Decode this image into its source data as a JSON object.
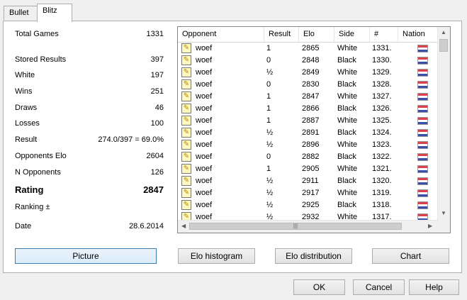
{
  "tabs": [
    {
      "label": "Bullet"
    },
    {
      "label": "Blitz"
    }
  ],
  "stats": {
    "total_games": {
      "label": "Total Games",
      "value": "1331"
    },
    "stored_results": {
      "label": "Stored Results",
      "value": "397"
    },
    "white": {
      "label": "White",
      "value": "197"
    },
    "wins": {
      "label": "Wins",
      "value": "251"
    },
    "draws": {
      "label": "Draws",
      "value": "46"
    },
    "losses": {
      "label": "Losses",
      "value": "100"
    },
    "result": {
      "label": "Result",
      "value": "274.0/397 = 69.0%"
    },
    "opponents_elo": {
      "label": "Opponents Elo",
      "value": "2604"
    },
    "n_opponents": {
      "label": "N Opponents",
      "value": "126"
    },
    "rating": {
      "label": "Rating",
      "value": "2847"
    },
    "ranking": {
      "label": "Ranking ±",
      "value": ""
    },
    "date": {
      "label": "Date",
      "value": "28.6.2014"
    }
  },
  "table": {
    "headers": {
      "opponent": "Opponent",
      "result": "Result",
      "elo": "Elo",
      "side": "Side",
      "num": "#",
      "nation": "Nation"
    },
    "rows": [
      {
        "opponent": "woef",
        "result": "1",
        "elo": "2865",
        "side": "White",
        "num": "1331."
      },
      {
        "opponent": "woef",
        "result": "0",
        "elo": "2848",
        "side": "Black",
        "num": "1330."
      },
      {
        "opponent": "woef",
        "result": "½",
        "elo": "2849",
        "side": "White",
        "num": "1329."
      },
      {
        "opponent": "woef",
        "result": "0",
        "elo": "2830",
        "side": "Black",
        "num": "1328."
      },
      {
        "opponent": "woef",
        "result": "1",
        "elo": "2847",
        "side": "White",
        "num": "1327."
      },
      {
        "opponent": "woef",
        "result": "1",
        "elo": "2866",
        "side": "Black",
        "num": "1326."
      },
      {
        "opponent": "woef",
        "result": "1",
        "elo": "2887",
        "side": "White",
        "num": "1325."
      },
      {
        "opponent": "woef",
        "result": "½",
        "elo": "2891",
        "side": "Black",
        "num": "1324."
      },
      {
        "opponent": "woef",
        "result": "½",
        "elo": "2896",
        "side": "White",
        "num": "1323."
      },
      {
        "opponent": "woef",
        "result": "0",
        "elo": "2882",
        "side": "Black",
        "num": "1322."
      },
      {
        "opponent": "woef",
        "result": "1",
        "elo": "2905",
        "side": "White",
        "num": "1321."
      },
      {
        "opponent": "woef",
        "result": "½",
        "elo": "2911",
        "side": "Black",
        "num": "1320."
      },
      {
        "opponent": "woef",
        "result": "½",
        "elo": "2917",
        "side": "White",
        "num": "1319."
      },
      {
        "opponent": "woef",
        "result": "½",
        "elo": "2925",
        "side": "Black",
        "num": "1318."
      },
      {
        "opponent": "woef",
        "result": "½",
        "elo": "2932",
        "side": "White",
        "num": "1317."
      }
    ]
  },
  "icons": {
    "row_icon": "pencil-icon",
    "nation_flag": "netherlands-flag-icon"
  },
  "buttons": {
    "picture": "Picture",
    "elo_histogram": "Elo histogram",
    "elo_distribution": "Elo distribution",
    "chart": "Chart",
    "ok": "OK",
    "cancel": "Cancel",
    "help": "Help"
  }
}
